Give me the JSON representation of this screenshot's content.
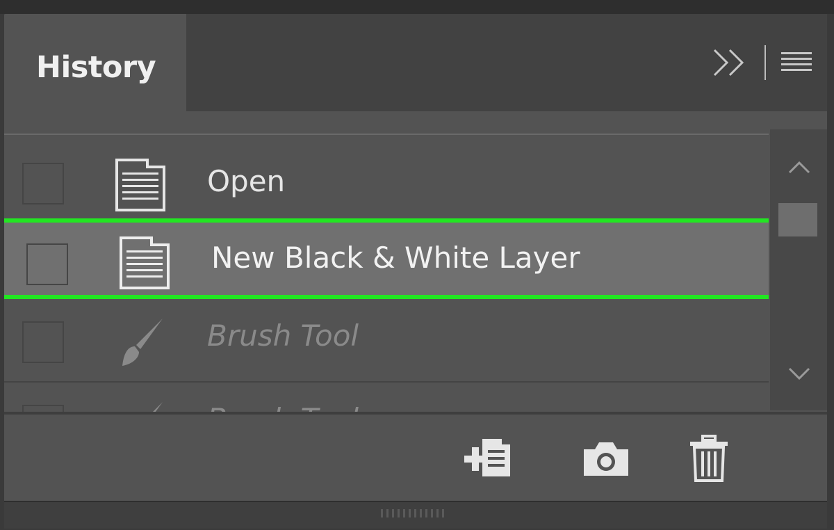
{
  "panel": {
    "tab_label": "History"
  },
  "header_controls": {
    "collapse_icon": "double-chevron-right-icon",
    "menu_icon": "hamburger-menu-icon"
  },
  "history": {
    "items": [
      {
        "label": "Open",
        "icon": "document-icon",
        "state": "normal"
      },
      {
        "label": "New Black & White Layer",
        "icon": "document-icon",
        "state": "selected"
      },
      {
        "label": "Brush Tool",
        "icon": "brush-icon",
        "state": "dimmed"
      },
      {
        "label": "Brush Tool",
        "icon": "brush-icon",
        "state": "dimmed-partial"
      }
    ]
  },
  "toolbar": {
    "buttons": [
      {
        "icon": "new-document-from-state-icon"
      },
      {
        "icon": "camera-snapshot-icon"
      },
      {
        "icon": "trash-icon"
      }
    ]
  },
  "colors": {
    "panel_bg": "#535353",
    "selected_row_bg": "#707070",
    "highlight_outline": "#22e622",
    "text_normal": "#e6e6e6",
    "text_dimmed": "#8a8a8a"
  }
}
